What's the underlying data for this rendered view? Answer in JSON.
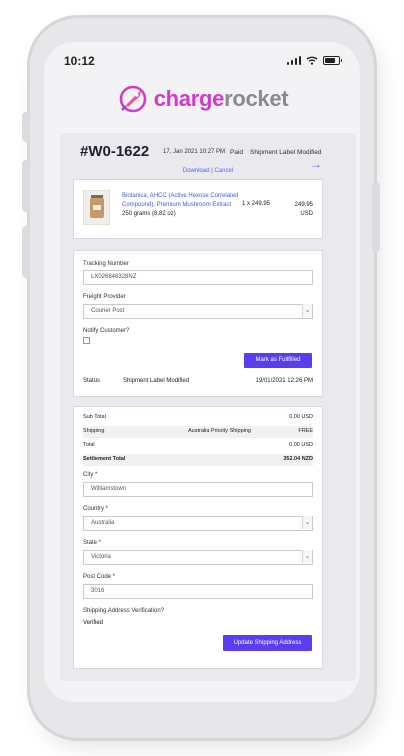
{
  "status_bar": {
    "time": "10:12"
  },
  "brand": {
    "part1": "charge",
    "part2": "rocket"
  },
  "order": {
    "id": "#W0-1622",
    "date": "17, Jan 2021 10:27 PM",
    "payment_status": "Paid",
    "shipment_status": "Shipment Label Modified",
    "links": {
      "download": "Download",
      "separator": "|",
      "cancel": "Cancel"
    }
  },
  "product": {
    "name": "Biotanica, AHCC (Active Hexose Correlated Compound), Premium Mushroom Extract",
    "weight": "250 grams (8.82 oz)",
    "quantity_price": "1 x 249.95",
    "total": "249.95",
    "currency": "USD"
  },
  "fulfillment": {
    "tracking_label": "Tracking Number",
    "tracking_value": "LX026846328NZ",
    "provider_label": "Freight Provider",
    "provider_value": "Courier Post",
    "notify_label": "Notify Customer?",
    "notify_checked": false,
    "fulfil_button": "Mark as Fullfilled",
    "status_label": "Status",
    "status_value": "Shipment Label Modified",
    "status_date": "19/01/2021 12:26 PM"
  },
  "summary": {
    "subtotal_label": "Sub Total",
    "subtotal_value": "0.00 USD",
    "shipping_label": "Shipping",
    "shipping_method": "Australia Priority Shipping",
    "shipping_value": "FREE",
    "total_label": "Total",
    "total_value": "0.00 USD",
    "settlement_label": "Settlement Total",
    "settlement_value": "352.04 NZD"
  },
  "address": {
    "city_label": "City *",
    "city_value": "Williamstown",
    "country_label": "Country *",
    "country_value": "Australia",
    "state_label": "State *",
    "state_value": "Victoria",
    "postcode_label": "Post Code *",
    "postcode_value": "3016",
    "verification_label": "Shipping Address Verification?",
    "verification_value": "Verified",
    "update_button": "Update Shipping Address"
  },
  "colors": {
    "accent": "#5b3df0",
    "link": "#4b6ae8",
    "brand_pink": "#d13acd",
    "brand_gray": "#8a8a93"
  }
}
